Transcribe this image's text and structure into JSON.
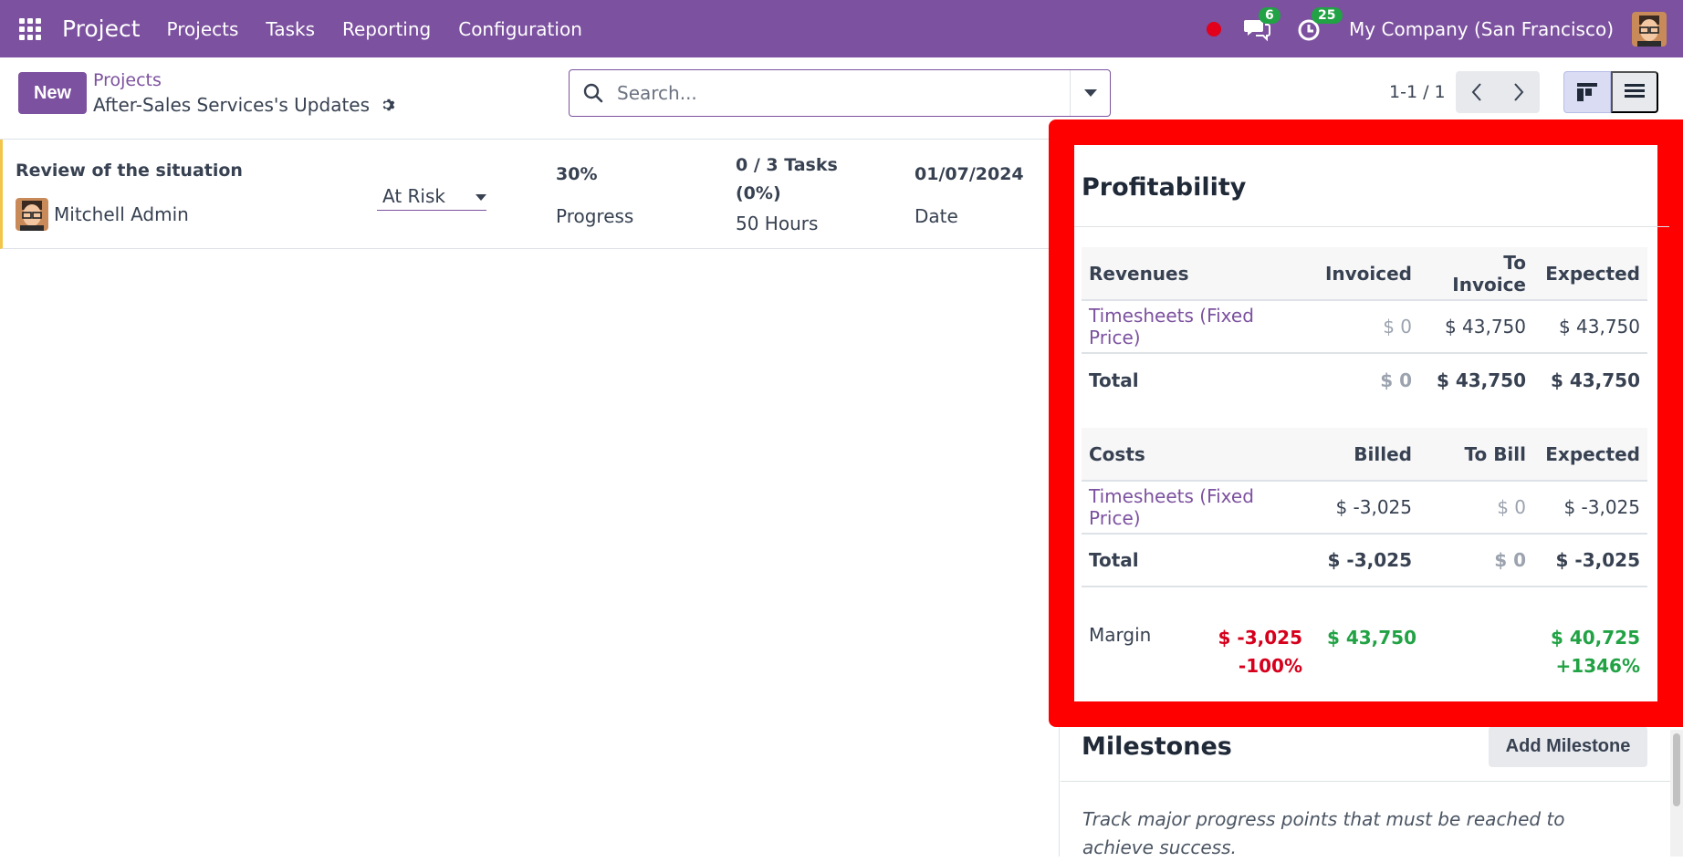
{
  "navbar": {
    "app_name": "Project",
    "menu": [
      "Projects",
      "Tasks",
      "Reporting",
      "Configuration"
    ],
    "messages_count": "6",
    "activities_count": "25",
    "company": "My Company (San Francisco)",
    "icons": [
      "apps-grid-icon",
      "record-dot-icon",
      "chat-icon",
      "clock-icon",
      "user-avatar"
    ]
  },
  "control": {
    "new_label": "New",
    "breadcrumb_parent": "Projects",
    "breadcrumb_current": "After-Sales Services's Updates",
    "search_placeholder": "Search...",
    "pager": "1-1 / 1"
  },
  "update": {
    "title": "Review of the situation",
    "user": "Mitchell Admin",
    "status": "At Risk",
    "progress_value": "30%",
    "progress_label": "Progress",
    "tasks_line1": "0 / 3 Tasks",
    "tasks_line2": "(0%)",
    "hours": "50 Hours",
    "date_value": "01/07/2024",
    "date_label": "Date"
  },
  "profitability": {
    "title": "Profitability",
    "revenues": {
      "headers": [
        "Revenues",
        "Invoiced",
        "To Invoice",
        "Expected"
      ],
      "row": [
        "Timesheets (Fixed Price)",
        "$ 0",
        "$ 43,750",
        "$ 43,750"
      ],
      "total": [
        "Total",
        "$ 0",
        "$ 43,750",
        "$ 43,750"
      ]
    },
    "costs": {
      "headers": [
        "Costs",
        "Billed",
        "To Bill",
        "Expected"
      ],
      "row": [
        "Timesheets (Fixed Price)",
        "$ -3,025",
        "$ 0",
        "$ -3,025"
      ],
      "total": [
        "Total",
        "$ -3,025",
        "$ 0",
        "$ -3,025"
      ]
    },
    "margin": {
      "label": "Margin",
      "col1_value": "$ -3,025",
      "col1_pct": "-100%",
      "col2_value": "$ 43,750",
      "col3_value": "$ 40,725",
      "col3_pct": "+1346%"
    }
  },
  "milestones": {
    "title": "Milestones",
    "add_label": "Add Milestone",
    "empty_text": "Track major progress points that must be reached to achieve success."
  },
  "colors": {
    "brand": "#7c519f",
    "highlight": "#ff0000",
    "negative": "#d6001c",
    "positive": "#21a244",
    "badge": "#21a244"
  }
}
